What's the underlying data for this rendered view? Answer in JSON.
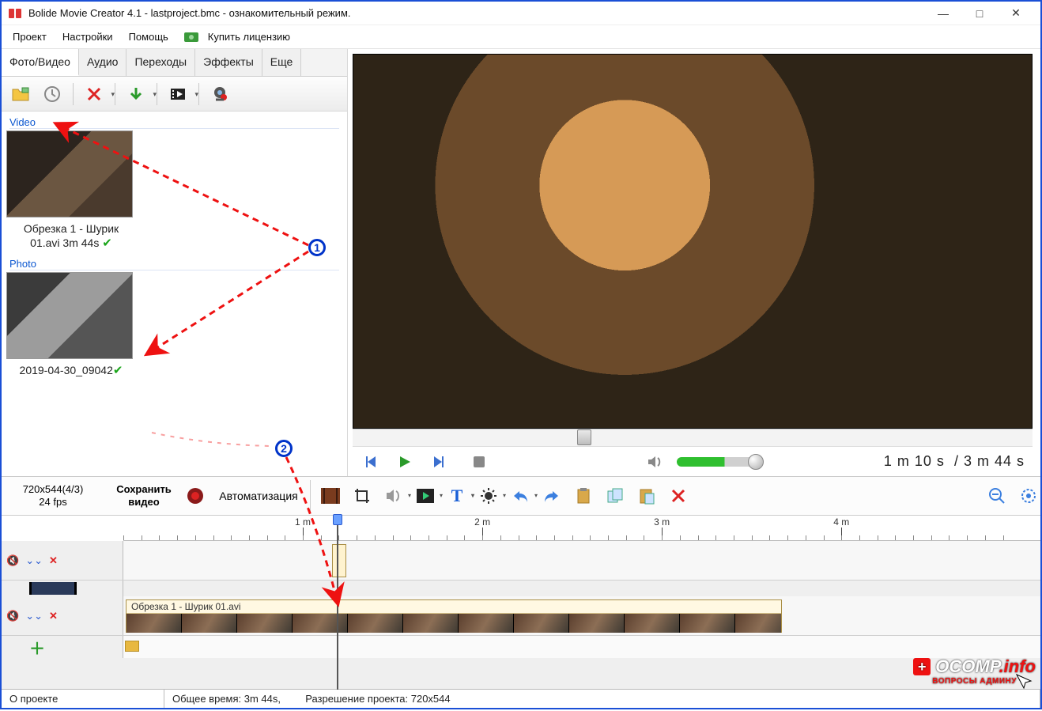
{
  "window": {
    "title": "Bolide Movie Creator 4.1 - lastproject.bmc  - ознакомительный режим."
  },
  "menu": {
    "project": "Проект",
    "settings": "Настройки",
    "help": "Помощь",
    "buy": "Купить лицензию"
  },
  "tabs": {
    "photo_video": "Фото/Видео",
    "audio": "Аудио",
    "transitions": "Переходы",
    "effects": "Эффекты",
    "more": "Еще"
  },
  "library": {
    "video_label": "Video",
    "photo_label": "Photo",
    "video_item": {
      "title_line1": "Обрезка 1 - Шурик",
      "title_line2": "01.avi 3m 44s"
    },
    "photo_item": {
      "title": "2019-04-30_09042"
    }
  },
  "player": {
    "current": "1 m 10 s",
    "sep": "/",
    "total": "3 m 44 s"
  },
  "midbar": {
    "resolution_line1": "720x544(4/3)",
    "resolution_line2": "24 fps",
    "save_line1": "Сохранить",
    "save_line2": "видео",
    "automation": "Автоматизация"
  },
  "ruler": {
    "m1": "1 m",
    "m2": "2 m",
    "m3": "3 m",
    "m4": "4 m"
  },
  "timeline": {
    "clip_label": "Обрезка 1 - Шурик 01.avi"
  },
  "status": {
    "about": "О проекте",
    "total": "Общее время: 3m 44s,",
    "res": "Разрешение проекта:   720x544"
  },
  "watermark": {
    "brand": "OCOMP",
    "tld": ".info",
    "sub": "ВОПРОСЫ АДМИНУ"
  },
  "annotations": {
    "one": "1",
    "two": "2"
  }
}
